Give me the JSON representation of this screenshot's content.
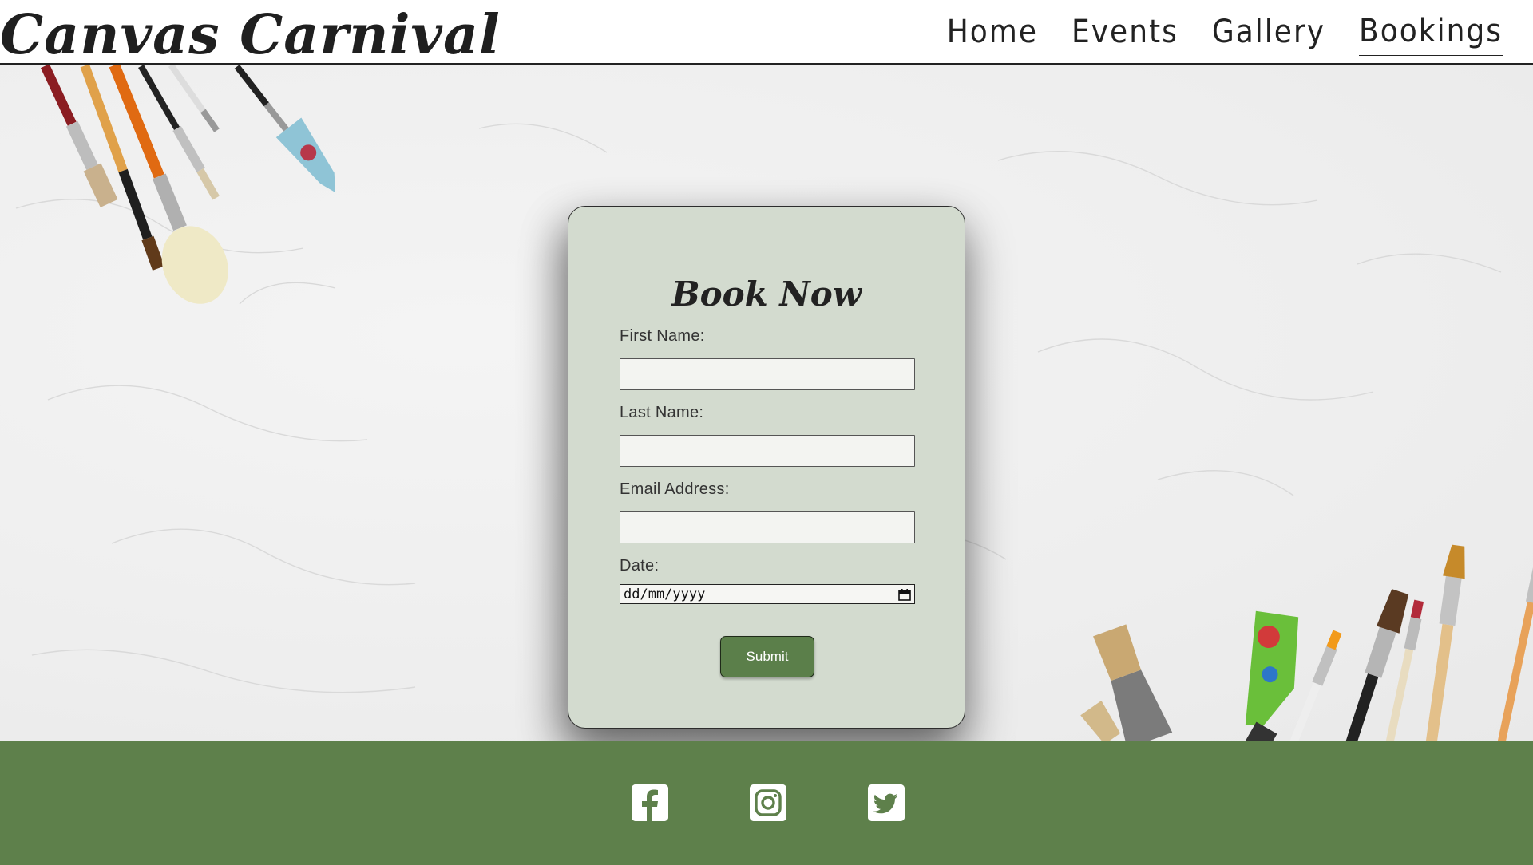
{
  "header": {
    "logo": "Canvas Carnival",
    "nav": [
      {
        "label": "Home"
      },
      {
        "label": "Events"
      },
      {
        "label": "Gallery"
      },
      {
        "label": "Bookings",
        "active": true
      }
    ]
  },
  "form": {
    "title": "Book Now",
    "first_name_label": "First Name:",
    "first_name_value": "",
    "last_name_label": "Last Name:",
    "last_name_value": "",
    "email_label": "Email Address:",
    "email_value": "",
    "date_label": "Date:",
    "date_placeholder": "dd/mm/yyyy",
    "submit_label": "Submit"
  },
  "footer": {
    "social": [
      "facebook-icon",
      "instagram-icon",
      "twitter-icon"
    ]
  },
  "colors": {
    "card_bg": "#d3dbcf",
    "accent_green": "#5b7f4a",
    "footer_green": "#5e804b"
  }
}
